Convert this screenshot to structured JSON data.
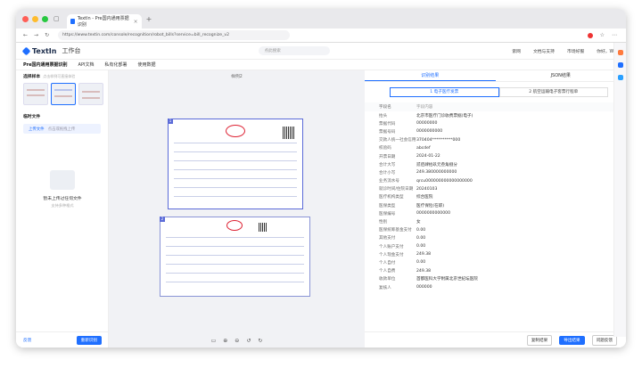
{
  "browser": {
    "tab_title": "TextIn - Pre国内通用票据识别",
    "url": "https://www.textin.com/console/recognition/robot_bills?service=bill_recognize_v2",
    "colors": {
      "close": "#ff5f57",
      "min": "#febc2e",
      "max": "#28c840"
    }
  },
  "header": {
    "brand": "TextIn",
    "workspace": "工作台",
    "search_placeholder": "点此搜索",
    "links": [
      "索网",
      "文档与支持",
      "市场好服",
      "你好，Wen"
    ]
  },
  "subheader": {
    "title": "Pre国内通用票据识别",
    "items": [
      "API文档",
      "私有化部署",
      "使用数据"
    ]
  },
  "left": {
    "samples_title": "选择样本",
    "samples_hint": "点击样例可直接体验",
    "temp_files": "临时文件",
    "upload_label": "上传文件",
    "upload_hint": "点击或拖拽上传",
    "empty_title": "暂未上传过任何文件",
    "empty_hint": "支持多种格式",
    "bottom_left": "反馈",
    "bottom_btn": "重新识别"
  },
  "center": {
    "title": "样例2"
  },
  "right": {
    "tabs": [
      "识别结果",
      "JSON结果"
    ],
    "switch": [
      "1 电子医疗发票",
      "2 航空运输电子客票行程单"
    ],
    "col_head": [
      "字段名",
      "字段内容"
    ],
    "rows": [
      [
        "抬头",
        "北京市医疗门诊收费票据(电子)"
      ],
      [
        "票据代码",
        "00000000"
      ],
      [
        "票据号码",
        "0000000000"
      ],
      [
        "交款人统一社会信用代码",
        "370404**********000"
      ],
      [
        "校验码",
        "abcdef"
      ],
      [
        "开票日期",
        "2024-01-22"
      ],
      [
        "合计大写",
        "贰佰肆拾玖元叁角捌分"
      ],
      [
        "合计小写",
        "249.380000000000"
      ],
      [
        "业务流水号",
        "qrcu000000000000000000"
      ],
      [
        "就诊时间/住院日期",
        "20240103"
      ],
      [
        "医疗机构类型",
        "综合医院"
      ],
      [
        "医保类型",
        "医疗保险(在职)"
      ],
      [
        "医保编号",
        "0000000000000"
      ],
      [
        "性别",
        "女"
      ],
      [
        "医保统筹基金支付",
        "0.00"
      ],
      [
        "其他支付",
        "0.00"
      ],
      [
        "个人账户支付",
        "0.00"
      ],
      [
        "个人现金支付",
        "249.38"
      ],
      [
        "个人自付",
        "0.00"
      ],
      [
        "个人自费",
        "249.38"
      ],
      [
        "收款单位",
        "首都医科大学附属北京世纪坛医院"
      ],
      [
        "复核人",
        "000000"
      ]
    ],
    "btn_copy": "复制结果",
    "btn_export": "导出结果",
    "btn_feedback": "问题反馈"
  }
}
